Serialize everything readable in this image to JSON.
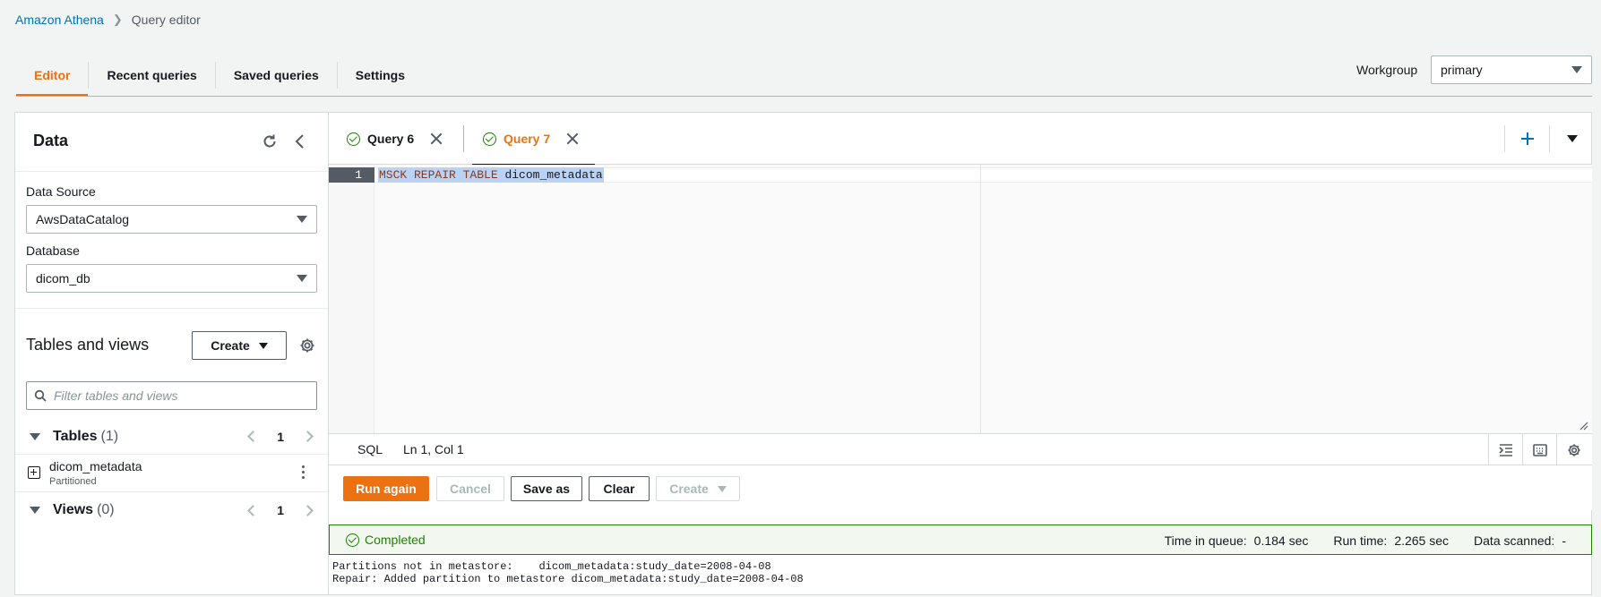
{
  "breadcrumb": {
    "root": "Amazon Athena",
    "current": "Query editor"
  },
  "top_tabs": [
    "Editor",
    "Recent queries",
    "Saved queries",
    "Settings"
  ],
  "workgroup": {
    "label": "Workgroup",
    "value": "primary"
  },
  "data_panel": {
    "title": "Data",
    "data_source_label": "Data Source",
    "data_source_value": "AwsDataCatalog",
    "database_label": "Database",
    "database_value": "dicom_db",
    "tables_views_title": "Tables and views",
    "create_label": "Create",
    "filter_placeholder": "Filter tables and views",
    "tables": {
      "title": "Tables",
      "count": "(1)",
      "page": "1",
      "items": [
        {
          "name": "dicom_metadata",
          "sub": "Partitioned"
        }
      ]
    },
    "views": {
      "title": "Views",
      "count": "(0)",
      "page": "1"
    }
  },
  "query_tabs": [
    {
      "label": "Query 6",
      "active": false
    },
    {
      "label": "Query 7",
      "active": true
    }
  ],
  "editor": {
    "line_number": "1",
    "code_keywords": "MSCK REPAIR TABLE",
    "code_ident": "dicom_metadata",
    "language": "SQL",
    "cursor_pos": "Ln 1, Col 1"
  },
  "actions": {
    "run": "Run again",
    "cancel": "Cancel",
    "save_as": "Save as",
    "clear": "Clear",
    "create": "Create"
  },
  "status": {
    "text": "Completed",
    "time_in_queue_label": "Time in queue:",
    "time_in_queue": "0.184 sec",
    "run_time_label": "Run time:",
    "run_time": "2.265 sec",
    "data_scanned_label": "Data scanned:",
    "data_scanned": "-"
  },
  "output": {
    "line1": "Partitions not in metastore:    dicom_metadata:study_date=2008-04-08",
    "line2": "Repair: Added partition to metastore dicom_metadata:study_date=2008-04-08"
  },
  "colors": {
    "accent": "#ec7211",
    "link": "#0073bb",
    "success": "#1d8102"
  }
}
